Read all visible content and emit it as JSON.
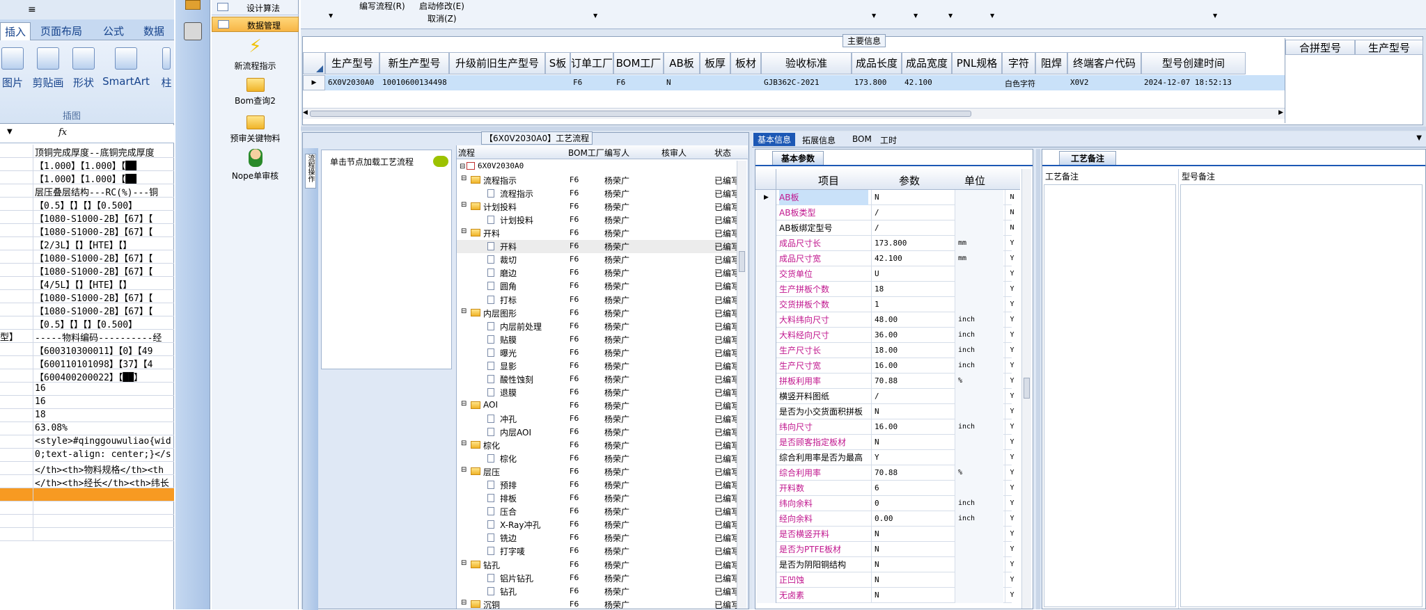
{
  "excel": {
    "tabs": [
      "插入",
      "页面布局",
      "公式",
      "数据"
    ],
    "ribbon_buttons": [
      "图片",
      "剪贴画",
      "形状",
      "SmartArt",
      "柱"
    ],
    "ribbon_group": "插图",
    "formula_fx": "fx",
    "rows": [
      {
        "a": "",
        "b": "顶铜完成厚度--底铜完成厚度"
      },
      {
        "a": "",
        "b": "【1.000】【1.000】【██"
      },
      {
        "a": "",
        "b": "【1.000】【1.000】【██"
      },
      {
        "a": "",
        "b": "层压叠层结构---RC(%)---铜"
      },
      {
        "a": "",
        "b": "【0.5】【】【】【0.500】"
      },
      {
        "a": "",
        "b": "【1080-S1000-2B】【67】【"
      },
      {
        "a": "",
        "b": "【1080-S1000-2B】【67】【"
      },
      {
        "a": "",
        "b": "【2/3L】【】【HTE】【】"
      },
      {
        "a": "",
        "b": "【1080-S1000-2B】【67】【"
      },
      {
        "a": "",
        "b": "【1080-S1000-2B】【67】【"
      },
      {
        "a": "",
        "b": "【4/5L】【】【HTE】【】"
      },
      {
        "a": "",
        "b": "【1080-S1000-2B】【67】【"
      },
      {
        "a": "",
        "b": "【1080-S1000-2B】【67】【"
      },
      {
        "a": "",
        "b": "【0.5】【】【】【0.500】"
      },
      {
        "a": "型】",
        "b": "-----物料编码----------经"
      },
      {
        "a": "",
        "b": "【600310300011】【0】【49"
      },
      {
        "a": "",
        "b": "【600110101098】【37】【4"
      },
      {
        "a": "",
        "b": "【600400200022】【██】"
      },
      {
        "a": "",
        "b": "16"
      },
      {
        "a": "",
        "b": "16"
      },
      {
        "a": "",
        "b": "18"
      },
      {
        "a": "",
        "b": "63.08%"
      },
      {
        "a": "",
        "b": "<style>#qinggouwuliao{wid"
      },
      {
        "a": "",
        "b": "0;text-align: center;}</s"
      },
      {
        "a": "",
        "b": "</th><th>物料规格</th><th"
      },
      {
        "a": "",
        "b": "</th><th>经长</th><th>纬长"
      },
      {
        "a": "",
        "b": ""
      },
      {
        "a": "",
        "b": ""
      },
      {
        "a": "",
        "b": ""
      },
      {
        "a": "",
        "b": ""
      }
    ]
  },
  "nav": {
    "top_items": [
      "设计算法",
      "数据管理"
    ],
    "items": [
      "新流程指示",
      "Bom查询2",
      "预审关键物料",
      "Nope单审核"
    ]
  },
  "toolbar": {
    "write_flow": "编写流程(R)",
    "start_modify": "启动修改(E)",
    "cancel": "取消(Z)"
  },
  "main_info": {
    "title": "主要信息",
    "columns": [
      "生产型号",
      "新生产型号",
      "升级前旧生产型号",
      "S板",
      "订单工厂",
      "BOM工厂",
      "AB板",
      "板厚",
      "板材",
      "验收标准",
      "成品长度",
      "成品宽度",
      "PNL规格",
      "字符",
      "阻焊",
      "终端客户代码",
      "型号创建时间"
    ],
    "row": [
      "6X0V2030A0",
      "10010600134498",
      "",
      "",
      "F6",
      "F6",
      "N",
      "",
      "",
      "GJB362C-2021",
      "173.800",
      "42.100",
      "",
      "白色字符",
      "",
      "X0V2",
      "2024-12-07 18:52:13"
    ],
    "side_columns": [
      "合拼型号",
      "生产型号"
    ]
  },
  "process": {
    "title": "【6X0V2030A0】工艺流程",
    "side_tab": "流程操作",
    "load_hint": "单击节点加载工艺流程",
    "columns": [
      "流程",
      "BOM工厂",
      "编写人",
      "核审人",
      "状态"
    ],
    "root": "6X0V2030A0",
    "nodes": [
      {
        "name": "流程指示",
        "level": 1,
        "folder": true
      },
      {
        "name": "流程指示",
        "level": 2,
        "folder": false
      },
      {
        "name": "计划投料",
        "level": 1,
        "folder": true
      },
      {
        "name": "计划投料",
        "level": 2,
        "folder": false
      },
      {
        "name": "开料",
        "level": 1,
        "folder": true
      },
      {
        "name": "开料",
        "level": 2,
        "folder": false
      },
      {
        "name": "裁切",
        "level": 2,
        "folder": false
      },
      {
        "name": "磨边",
        "level": 2,
        "folder": false
      },
      {
        "name": "圆角",
        "level": 2,
        "folder": false
      },
      {
        "name": "打标",
        "level": 2,
        "folder": false
      },
      {
        "name": "内层图形",
        "level": 1,
        "folder": true
      },
      {
        "name": "内层前处理",
        "level": 2,
        "folder": false
      },
      {
        "name": "贴膜",
        "level": 2,
        "folder": false
      },
      {
        "name": "曝光",
        "level": 2,
        "folder": false
      },
      {
        "name": "显影",
        "level": 2,
        "folder": false
      },
      {
        "name": "酸性蚀刻",
        "level": 2,
        "folder": false
      },
      {
        "name": "退膜",
        "level": 2,
        "folder": false
      },
      {
        "name": "AOI",
        "level": 1,
        "folder": true
      },
      {
        "name": "冲孔",
        "level": 2,
        "folder": false
      },
      {
        "name": "内层AOI",
        "level": 2,
        "folder": false
      },
      {
        "name": "棕化",
        "level": 1,
        "folder": true
      },
      {
        "name": "棕化",
        "level": 2,
        "folder": false
      },
      {
        "name": "层压",
        "level": 1,
        "folder": true
      },
      {
        "name": "预排",
        "level": 2,
        "folder": false
      },
      {
        "name": "排板",
        "level": 2,
        "folder": false
      },
      {
        "name": "压合",
        "level": 2,
        "folder": false
      },
      {
        "name": "X-Ray冲孔",
        "level": 2,
        "folder": false
      },
      {
        "name": "铣边",
        "level": 2,
        "folder": false
      },
      {
        "name": "打字唛",
        "level": 2,
        "folder": false
      },
      {
        "name": "钻孔",
        "level": 1,
        "folder": true
      },
      {
        "name": "铝片钻孔",
        "level": 2,
        "folder": false
      },
      {
        "name": "钻孔",
        "level": 2,
        "folder": false
      },
      {
        "name": "沉铜",
        "level": 1,
        "folder": true
      }
    ],
    "bom_factory": "F6",
    "writer": "杨荣广",
    "status": "已编写"
  },
  "basic": {
    "tabs": [
      "基本信息",
      "拓展信息",
      "BOM",
      "工时"
    ],
    "sub_tab": "基本参数",
    "columns": [
      "项目",
      "参数",
      "单位"
    ],
    "rows": [
      {
        "item": "AB板",
        "value": "N",
        "unit": "",
        "flag": "N",
        "magenta": true
      },
      {
        "item": "AB板类型",
        "value": "/",
        "unit": "",
        "flag": "N",
        "magenta": true
      },
      {
        "item": "AB板绑定型号",
        "value": "/",
        "unit": "",
        "flag": "N",
        "magenta": false
      },
      {
        "item": "成品尺寸长",
        "value": "173.800",
        "unit": "mm",
        "flag": "Y",
        "magenta": true
      },
      {
        "item": "成品尺寸宽",
        "value": "42.100",
        "unit": "mm",
        "flag": "Y",
        "magenta": true
      },
      {
        "item": "交货单位",
        "value": "U",
        "unit": "",
        "flag": "Y",
        "magenta": true
      },
      {
        "item": "生产拼板个数",
        "value": "18",
        "unit": "",
        "flag": "Y",
        "magenta": true
      },
      {
        "item": "交货拼板个数",
        "value": "1",
        "unit": "",
        "flag": "Y",
        "magenta": true
      },
      {
        "item": "大料纬向尺寸",
        "value": "48.00",
        "unit": "inch",
        "flag": "Y",
        "magenta": true
      },
      {
        "item": "大料经向尺寸",
        "value": "36.00",
        "unit": "inch",
        "flag": "Y",
        "magenta": true
      },
      {
        "item": "生产尺寸长",
        "value": "18.00",
        "unit": "inch",
        "flag": "Y",
        "magenta": true
      },
      {
        "item": "生产尺寸宽",
        "value": "16.00",
        "unit": "inch",
        "flag": "Y",
        "magenta": true
      },
      {
        "item": "拼板利用率",
        "value": "70.88",
        "unit": "%",
        "flag": "Y",
        "magenta": true
      },
      {
        "item": "横竖开料图纸",
        "value": "/",
        "unit": "",
        "flag": "Y",
        "magenta": false
      },
      {
        "item": "是否为小交货面积拼板",
        "value": "N",
        "unit": "",
        "flag": "Y",
        "magenta": false
      },
      {
        "item": "纬向尺寸",
        "value": "16.00",
        "unit": "inch",
        "flag": "Y",
        "magenta": true
      },
      {
        "item": "是否顾客指定板材",
        "value": "N",
        "unit": "",
        "flag": "Y",
        "magenta": true
      },
      {
        "item": "综合利用率是否为最高",
        "value": "Y",
        "unit": "",
        "flag": "Y",
        "magenta": false
      },
      {
        "item": "综合利用率",
        "value": "70.88",
        "unit": "%",
        "flag": "Y",
        "magenta": true
      },
      {
        "item": "开料数",
        "value": "6",
        "unit": "",
        "flag": "Y",
        "magenta": true
      },
      {
        "item": "纬向余料",
        "value": "0",
        "unit": "inch",
        "flag": "Y",
        "magenta": true
      },
      {
        "item": "经向余料",
        "value": "0.00",
        "unit": "inch",
        "flag": "Y",
        "magenta": true
      },
      {
        "item": "是否横竖开料",
        "value": "N",
        "unit": "",
        "flag": "Y",
        "magenta": true
      },
      {
        "item": "是否为PTFE板材",
        "value": "N",
        "unit": "",
        "flag": "Y",
        "magenta": true
      },
      {
        "item": "是否为阴阳铜结构",
        "value": "N",
        "unit": "",
        "flag": "Y",
        "magenta": false
      },
      {
        "item": "正凹蚀",
        "value": "N",
        "unit": "",
        "flag": "Y",
        "magenta": true
      },
      {
        "item": "无卤素",
        "value": "N",
        "unit": "",
        "flag": "Y",
        "magenta": true
      }
    ]
  },
  "remark": {
    "tab": "工艺备注",
    "columns": [
      "工艺备注",
      "型号备注"
    ]
  }
}
